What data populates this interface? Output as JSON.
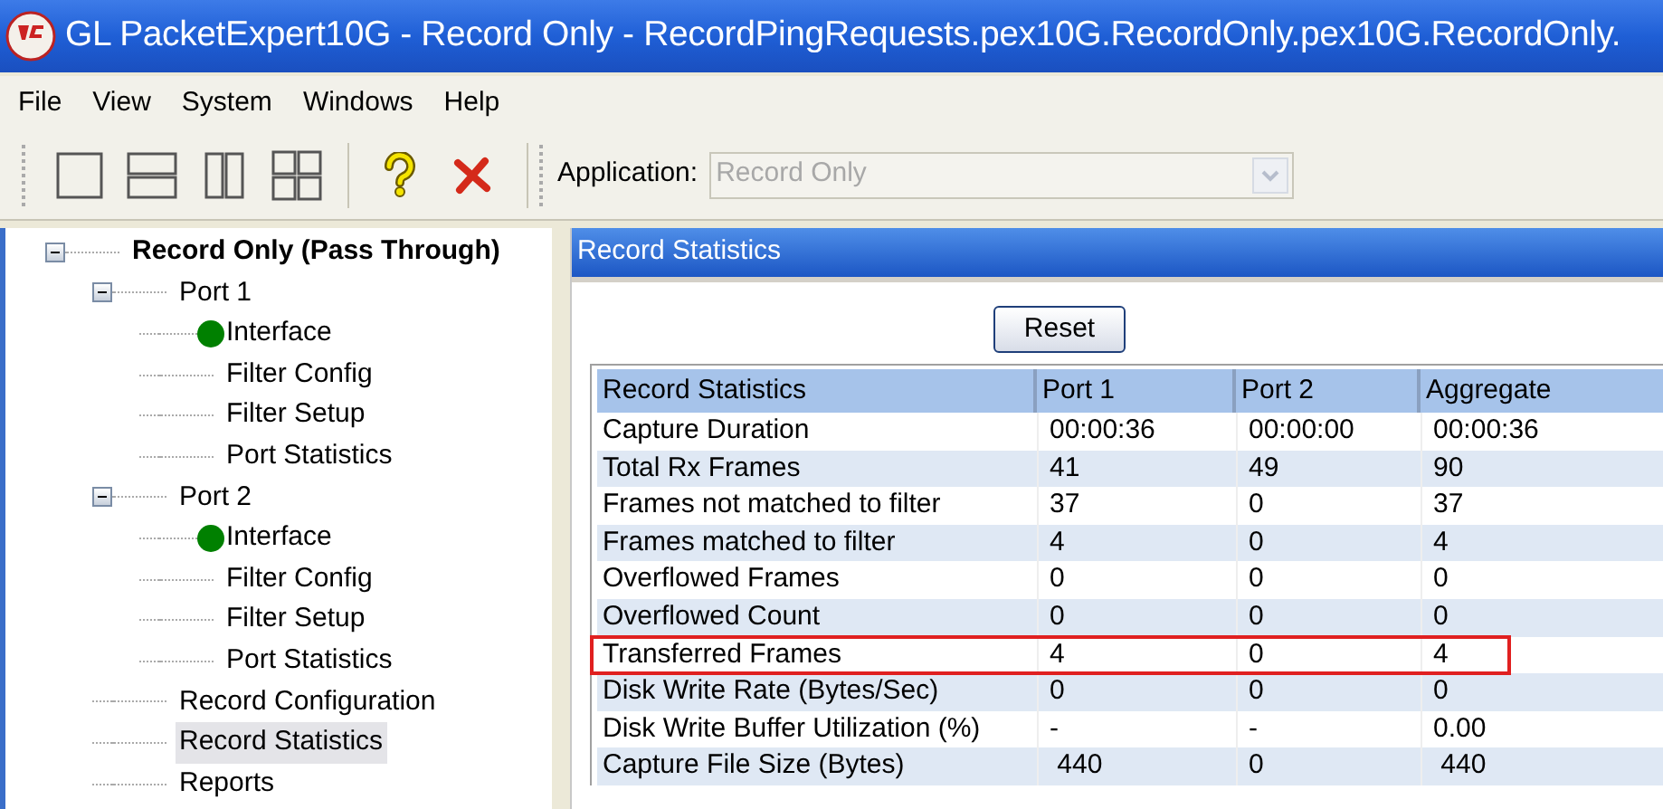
{
  "window": {
    "title": "GL PacketExpert10G - Record Only - RecordPingRequests.pex10G.RecordOnly.pex10G.RecordOnly."
  },
  "menu": [
    "File",
    "View",
    "System",
    "Windows",
    "Help"
  ],
  "toolbar": {
    "application_label": "Application:",
    "application": {
      "value": "Record Only",
      "disabled": true
    }
  },
  "tree": {
    "label": "Record Only (Pass Through)",
    "expanded": true,
    "selected": false,
    "children": [
      {
        "label": "Port 1",
        "expanded": true,
        "selected": false,
        "children": [
          {
            "label": "Interface",
            "color": "#008000",
            "selected": false
          },
          {
            "label": "Filter Config",
            "selected": false
          },
          {
            "label": "Filter Setup",
            "selected": false
          },
          {
            "label": "Port Statistics",
            "selected": false
          }
        ]
      },
      {
        "label": "Port 2",
        "expanded": true,
        "selected": false,
        "children": [
          {
            "label": "Interface",
            "color": "#008000",
            "selected": false
          },
          {
            "label": "Filter Config",
            "selected": false
          },
          {
            "label": "Filter Setup",
            "selected": false
          },
          {
            "label": "Port Statistics",
            "selected": false
          }
        ]
      },
      {
        "label": "Record Configuration",
        "selected": false
      },
      {
        "label": "Record Statistics",
        "selected": true
      },
      {
        "label": "Reports",
        "selected": false
      }
    ]
  },
  "panel": {
    "title": "Record Statistics",
    "reset_button": "Reset",
    "table": {
      "columns": [
        "Record Statistics",
        "Port 1",
        "Port 2",
        "Aggregate"
      ],
      "rows": [
        {
          "cells": [
            "Capture Duration",
            "00:00:36",
            "00:00:00",
            "00:00:36"
          ],
          "highlighted": false
        },
        {
          "cells": [
            "Total Rx Frames",
            "41",
            "49",
            "90"
          ],
          "highlighted": false
        },
        {
          "cells": [
            "Frames not matched to filter",
            "37",
            "0",
            "37"
          ],
          "highlighted": false
        },
        {
          "cells": [
            "Frames matched to filter",
            "4",
            "0",
            "4"
          ],
          "highlighted": false
        },
        {
          "cells": [
            "Overflowed Frames",
            "0",
            "0",
            "0"
          ],
          "highlighted": false
        },
        {
          "cells": [
            "Overflowed Count",
            "0",
            "0",
            "0"
          ],
          "highlighted": false
        },
        {
          "cells": [
            "Transferred Frames",
            "4",
            "0",
            "4"
          ],
          "highlighted": true
        },
        {
          "cells": [
            "Disk Write Rate (Bytes/Sec)",
            "0",
            "0",
            "0"
          ],
          "highlighted": false
        },
        {
          "cells": [
            "Disk Write Buffer Utilization (%)",
            "-",
            "-",
            "0.00"
          ],
          "highlighted": false
        },
        {
          "cells": [
            "Capture File Size (Bytes)",
            " 440",
            "0",
            " 440"
          ],
          "highlighted": false
        }
      ]
    }
  }
}
